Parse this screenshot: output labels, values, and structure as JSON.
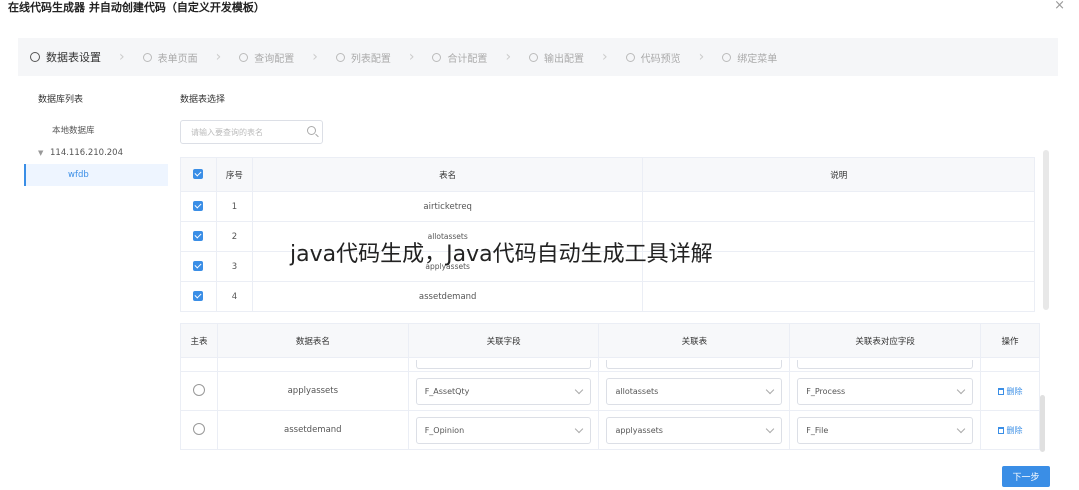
{
  "dialog": {
    "title": "在线代码生成器 并自动创建代码（自定义开发模板）",
    "close_label": "×"
  },
  "steps": [
    {
      "label": "数据表设置",
      "active": true
    },
    {
      "label": "表单页面",
      "active": false
    },
    {
      "label": "查询配置",
      "active": false
    },
    {
      "label": "列表配置",
      "active": false
    },
    {
      "label": "合计配置",
      "active": false
    },
    {
      "label": "输出配置",
      "active": false
    },
    {
      "label": "代码预览",
      "active": false
    },
    {
      "label": "绑定菜单",
      "active": false
    }
  ],
  "left_panel": {
    "title": "数据库列表",
    "tree": {
      "local": "本地数据库",
      "server": "114.116.210.204",
      "db": "wfdb"
    }
  },
  "right_panel": {
    "title": "数据表选择",
    "search_placeholder": "请输入要查询的表名"
  },
  "table_select": {
    "headers": {
      "index": "序号",
      "name": "表名",
      "desc": "说明"
    },
    "rows": [
      {
        "index": "1",
        "name": "airticketreq",
        "desc": ""
      },
      {
        "index": "2",
        "name": "allotassets",
        "desc": ""
      },
      {
        "index": "3",
        "name": "applyassets",
        "desc": ""
      },
      {
        "index": "4",
        "name": "assetdemand",
        "desc": ""
      }
    ]
  },
  "relation_table": {
    "headers": {
      "main": "主表",
      "table": "数据表名",
      "field": "关联字段",
      "rel_table": "关联表",
      "rel_field": "关联表对应字段",
      "action": "操作"
    },
    "rows": [
      {
        "table": "applyassets",
        "field": "F_AssetQty",
        "rel_table": "allotassets",
        "rel_field": "F_Process",
        "action": "删除"
      },
      {
        "table": "assetdemand",
        "field": "F_Opinion",
        "rel_table": "applyassets",
        "rel_field": "F_File",
        "action": "删除"
      }
    ]
  },
  "footer": {
    "next_label": "下一步"
  },
  "watermark": "java代码生成，Java代码自动生成工具详解"
}
